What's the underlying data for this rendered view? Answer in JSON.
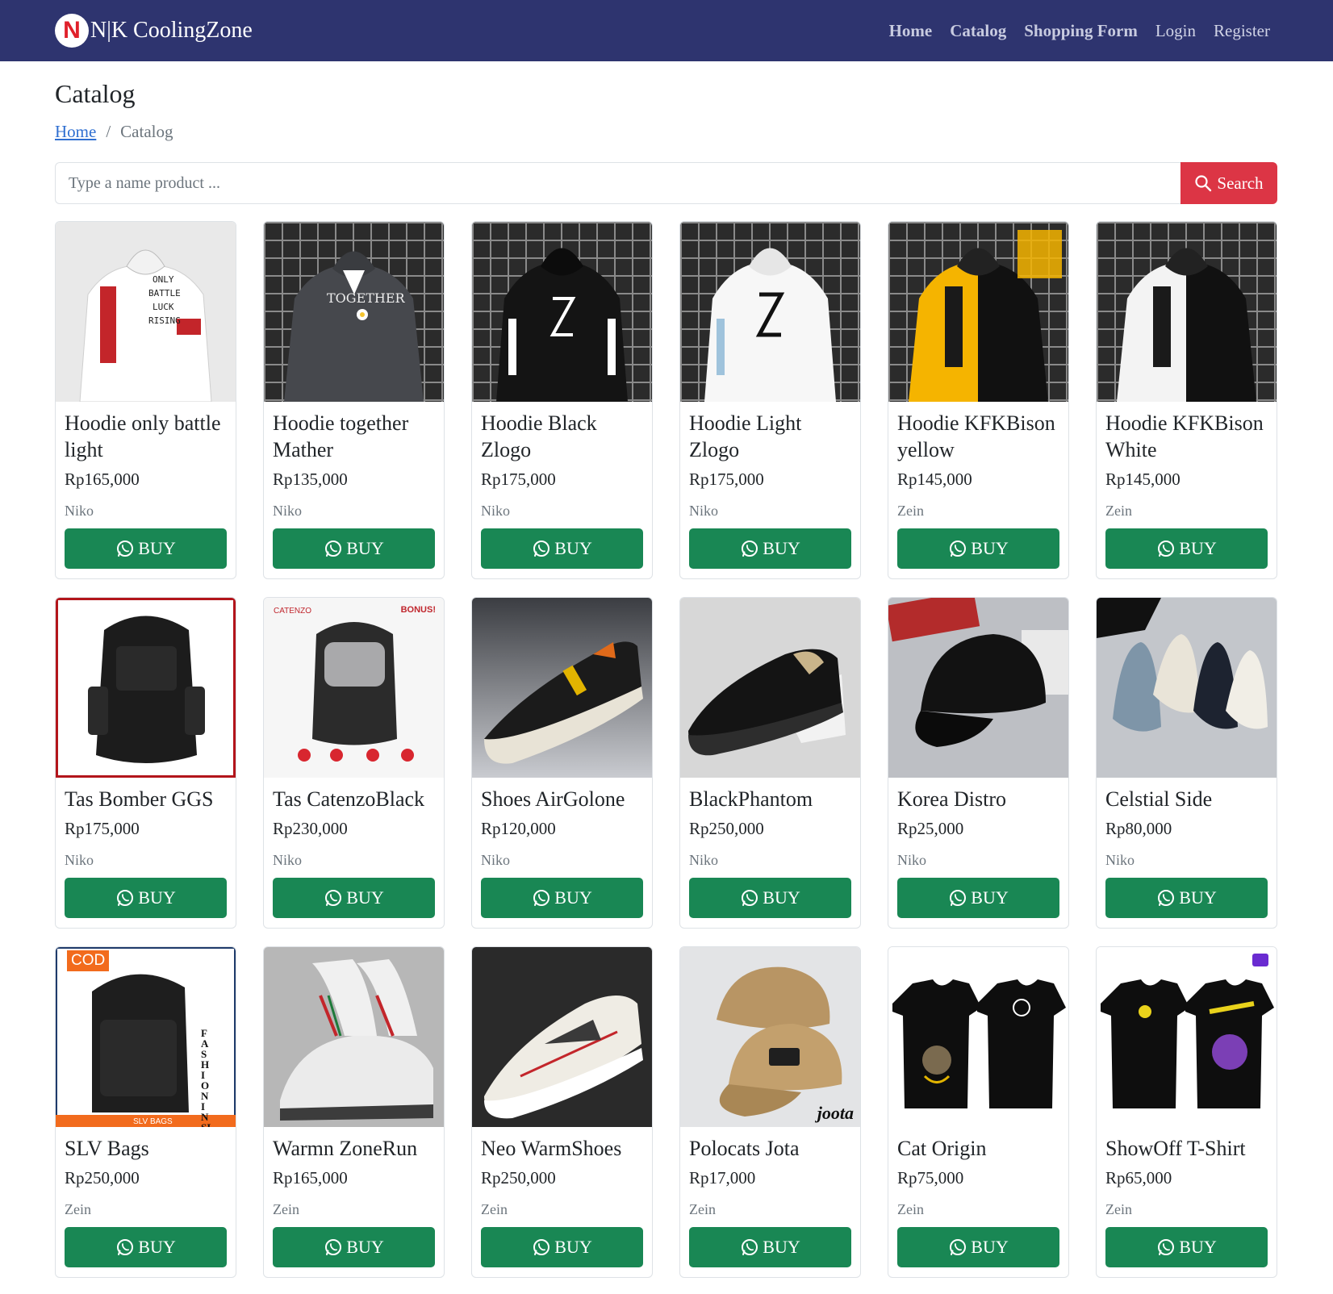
{
  "brand": {
    "logo_letter": "N",
    "name": "N|K CoolingZone"
  },
  "nav": {
    "home": "Home",
    "catalog": "Catalog",
    "shopping_form": "Shopping Form",
    "login": "Login",
    "register": "Register"
  },
  "page": {
    "title": "Catalog"
  },
  "breadcrumb": {
    "home": "Home",
    "separator": "/",
    "current": "Catalog"
  },
  "search": {
    "placeholder": "Type a name product ...",
    "button_label": "Search"
  },
  "buy_label": "BUY",
  "colors": {
    "navbar": "#2e346f",
    "search_button": "#dc3545",
    "buy_button": "#198754",
    "link": "#2f6fd1"
  },
  "products": [
    {
      "name": "Hoodie only battle light",
      "price": "Rp165,000",
      "seller": "Niko",
      "image": "white-hoodie-only-battle-light"
    },
    {
      "name": "Hoodie together Mather",
      "price": "Rp135,000",
      "seller": "Niko",
      "image": "grey-hoodie-together"
    },
    {
      "name": "Hoodie Black Zlogo",
      "price": "Rp175,000",
      "seller": "Niko",
      "image": "black-hoodie-zlogo"
    },
    {
      "name": "Hoodie Light Zlogo",
      "price": "Rp175,000",
      "seller": "Niko",
      "image": "white-hoodie-zlogo"
    },
    {
      "name": "Hoodie KFKBison yellow",
      "price": "Rp145,000",
      "seller": "Zein",
      "image": "yellow-black-hoodie-kfkbison"
    },
    {
      "name": "Hoodie KFKBison White",
      "price": "Rp145,000",
      "seller": "Zein",
      "image": "white-black-hoodie-kfkbison"
    },
    {
      "name": "Tas Bomber GGS",
      "price": "Rp175,000",
      "seller": "Niko",
      "image": "black-backpack"
    },
    {
      "name": "Tas CatenzoBlack",
      "price": "Rp230,000",
      "seller": "Niko",
      "image": "grey-black-backpack"
    },
    {
      "name": "Shoes AirGolone",
      "price": "Rp120,000",
      "seller": "Niko",
      "image": "black-white-sneaker"
    },
    {
      "name": "BlackPhantom",
      "price": "Rp250,000",
      "seller": "Niko",
      "image": "black-leather-sneaker"
    },
    {
      "name": "Korea Distro",
      "price": "Rp25,000",
      "seller": "Niko",
      "image": "black-cap"
    },
    {
      "name": "Celstial Side",
      "price": "Rp80,000",
      "seller": "Niko",
      "image": "canvas-sneakers"
    },
    {
      "name": "SLV Bags",
      "price": "Rp250,000",
      "seller": "Zein",
      "image": "black-backpack-fashion-insider"
    },
    {
      "name": "Warmn ZoneRun",
      "price": "Rp165,000",
      "seller": "Zein",
      "image": "white-running-shoes"
    },
    {
      "name": "Neo WarmShoes",
      "price": "Rp250,000",
      "seller": "Zein",
      "image": "white-grey-sneaker"
    },
    {
      "name": "Polocats Jota",
      "price": "Rp17,000",
      "seller": "Zein",
      "image": "tan-caps"
    },
    {
      "name": "Cat Origin",
      "price": "Rp75,000",
      "seller": "Zein",
      "image": "black-tshirts-cat"
    },
    {
      "name": "ShowOff T-Shirt",
      "price": "Rp65,000",
      "seller": "Zein",
      "image": "black-tshirts-showoff"
    }
  ],
  "image_text": {
    "catenzo_brand": "CATENZO",
    "catenzo_bonus": "BONUS!",
    "cod_badge": "COD",
    "fashion_insider": "FASHION INSIDER",
    "slv_bags": "SLV BAGS",
    "joota": "joota"
  }
}
